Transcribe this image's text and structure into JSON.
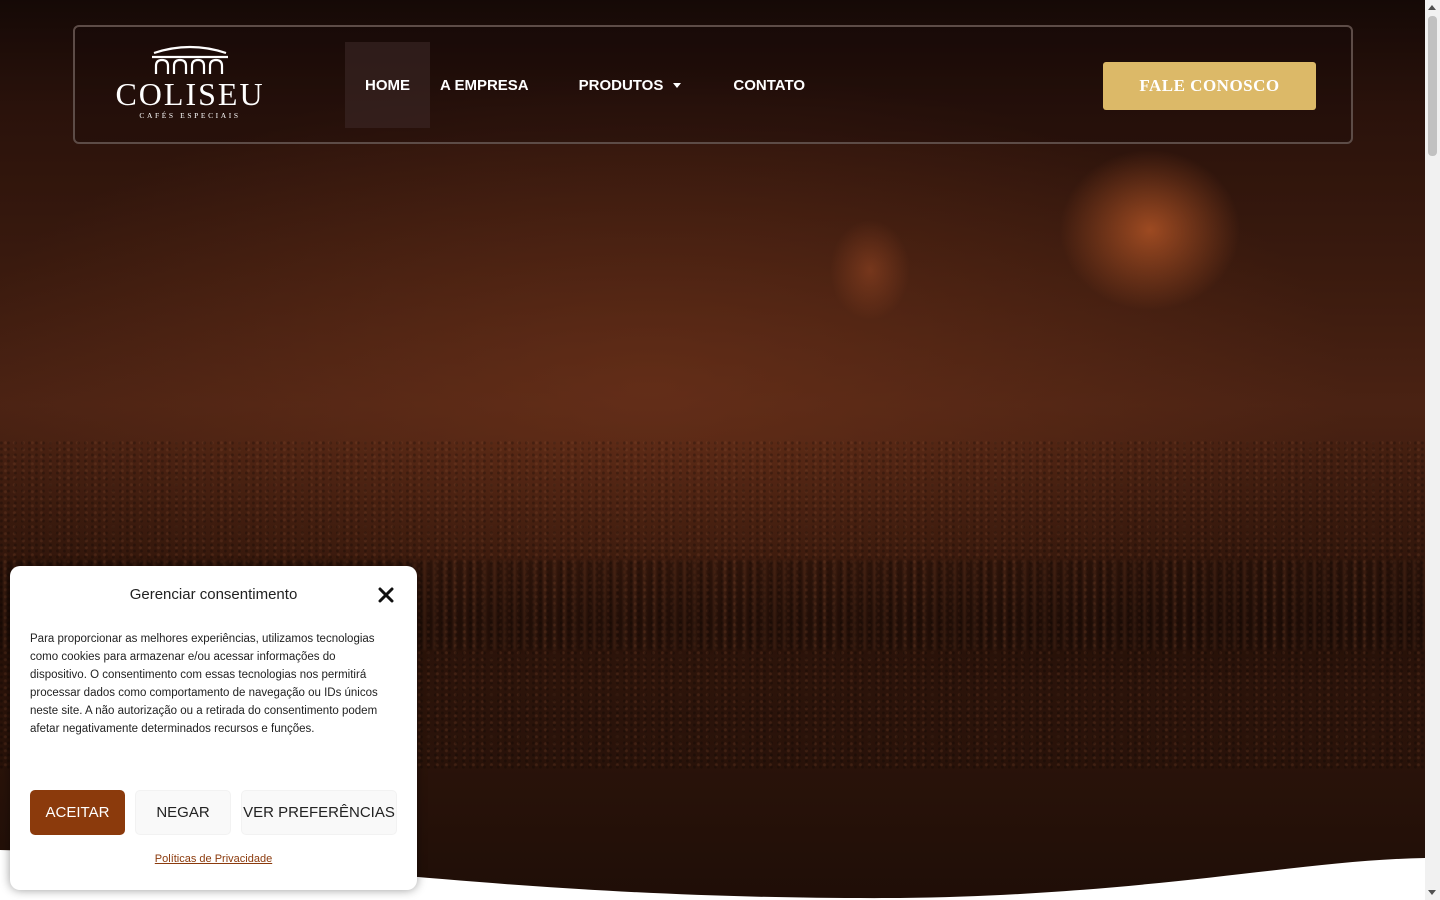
{
  "brand": {
    "name": "COLISEU",
    "tagline": "CAFÉS ESPECIAIS"
  },
  "nav": {
    "items": [
      {
        "label": "HOME",
        "active": true
      },
      {
        "label": "A EMPRESA",
        "active": false
      },
      {
        "label": "PRODUTOS",
        "active": false,
        "has_dropdown": true
      },
      {
        "label": "CONTATO",
        "active": false
      }
    ]
  },
  "header": {
    "cta_label": "FALE CONOSCO"
  },
  "consent": {
    "title": "Gerenciar consentimento",
    "body": "Para proporcionar as melhores experiências, utilizamos tecnologias como cookies para armazenar e/ou acessar informações do dispositivo. O consentimento com essas tecnologias nos permitirá processar dados como comportamento de navegação ou IDs únicos neste site. A não autorização ou a retirada do consentimento podem afetar negativamente determinados recursos e funções.",
    "accept_label": "ACEITAR",
    "deny_label": "NEGAR",
    "preferences_label": "VER PREFERÊNCIAS",
    "privacy_link": "Políticas de Privacidade"
  },
  "colors": {
    "accent_gold": "#dcb968",
    "accept_brown": "#8b3a0c",
    "header_border": "#5d4c47"
  },
  "icons": {
    "close": "close-icon",
    "dropdown": "chevron-down-icon",
    "logo": "colosseum-arches-logo"
  }
}
